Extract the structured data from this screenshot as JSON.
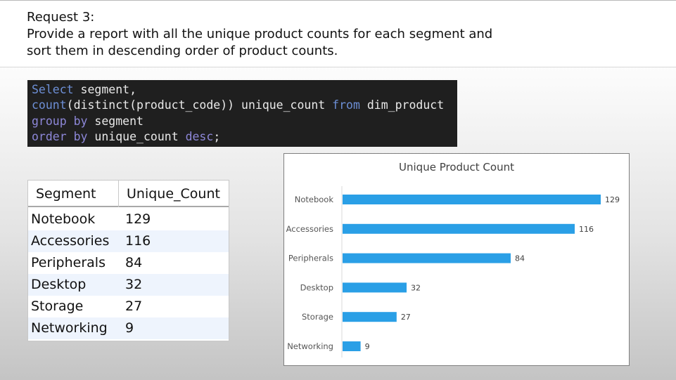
{
  "header": {
    "line1": "Request 3:",
    "line2": "Provide a report with all the unique product counts for each segment and",
    "line3": "sort them in descending order of product counts."
  },
  "sql": {
    "l1a": "Select",
    "l1b": " segment,",
    "l2a": "count",
    "l2b": "(distinct(product_code)) unique_count ",
    "l2c": "from",
    "l2d": " dim_product",
    "l3a": "group by",
    "l3b": " segment",
    "l4a": "order by",
    "l4b": " unique_count ",
    "l4c": "desc",
    "l4d": ";"
  },
  "result_table": {
    "headers": [
      "Segment",
      "Unique_Count"
    ],
    "rows": [
      [
        "Notebook",
        "129"
      ],
      [
        "Accessories",
        "116"
      ],
      [
        "Peripherals",
        "84"
      ],
      [
        "Desktop",
        "32"
      ],
      [
        "Storage",
        "27"
      ],
      [
        "Networking",
        "9"
      ]
    ]
  },
  "chart_data": {
    "type": "bar",
    "orientation": "horizontal",
    "title": "Unique Product Count",
    "categories": [
      "Notebook",
      "Accessories",
      "Peripherals",
      "Desktop",
      "Storage",
      "Networking"
    ],
    "values": [
      129,
      116,
      84,
      32,
      27,
      9
    ],
    "xlim": [
      0,
      129
    ],
    "grid": false,
    "legend": "none",
    "bar_color": "#2a9fe6"
  }
}
